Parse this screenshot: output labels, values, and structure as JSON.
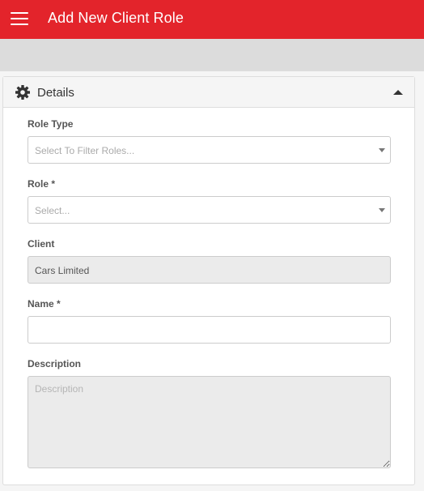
{
  "header": {
    "title": "Add New Client Role",
    "menu_icon": "hamburger-menu-icon",
    "background_color": "#e3242b"
  },
  "panel": {
    "title": "Details",
    "icon": "gear-icon",
    "collapse_icon": "caret-up-icon"
  },
  "form": {
    "role_type": {
      "label": "Role Type",
      "placeholder": "Select To Filter Roles..."
    },
    "role": {
      "label": "Role *",
      "placeholder": "Select..."
    },
    "client": {
      "label": "Client",
      "value": "Cars Limited"
    },
    "name": {
      "label": "Name *",
      "value": ""
    },
    "description": {
      "label": "Description",
      "placeholder": "Description"
    }
  }
}
